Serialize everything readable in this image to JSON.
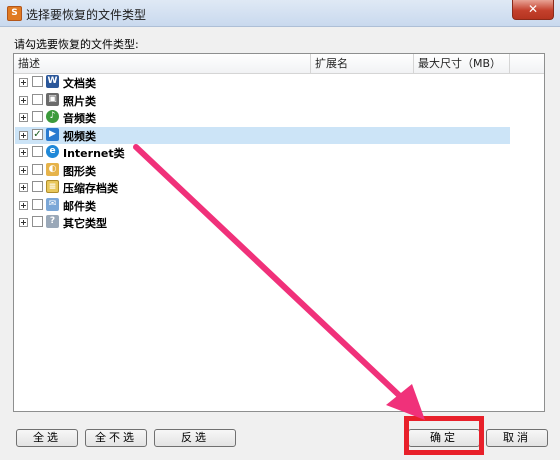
{
  "window": {
    "title": "选择要恢复的文件类型",
    "app_icon_glyph": "S",
    "close_glyph": "✕"
  },
  "prompt": "请勾选要恢复的文件类型:",
  "columns": [
    "描述",
    "扩展名",
    "最大尺寸（MB）"
  ],
  "rows": [
    {
      "label": "文档类",
      "icon": "document-icon",
      "glyph": "W",
      "checked": false,
      "selected": false
    },
    {
      "label": "照片类",
      "icon": "photo-icon",
      "glyph": "▣",
      "checked": false,
      "selected": false
    },
    {
      "label": "音频类",
      "icon": "audio-icon",
      "glyph": "♪",
      "checked": false,
      "selected": false
    },
    {
      "label": "视频类",
      "icon": "video-icon",
      "glyph": "▶",
      "checked": true,
      "selected": true
    },
    {
      "label": "Internet类",
      "icon": "internet-explorer-icon",
      "glyph": "e",
      "checked": false,
      "selected": false
    },
    {
      "label": "图形类",
      "icon": "image-icon",
      "glyph": "◐",
      "checked": false,
      "selected": false
    },
    {
      "label": "压缩存档类",
      "icon": "archive-icon",
      "glyph": "≡",
      "checked": false,
      "selected": false
    },
    {
      "label": "邮件类",
      "icon": "mail-icon",
      "glyph": "✉",
      "checked": false,
      "selected": false
    },
    {
      "label": "其它类型",
      "icon": "other-file-icon",
      "glyph": "?",
      "checked": false,
      "selected": false
    }
  ],
  "checkmark_glyph": "✓",
  "buttons": {
    "select_all": "全选",
    "select_none": "全不选",
    "invert": "反选",
    "ok": "确定",
    "cancel": "取消"
  },
  "colors": {
    "selection": "#cce4f7",
    "highlight": "#e8202a",
    "arrow": "#f0317a"
  }
}
